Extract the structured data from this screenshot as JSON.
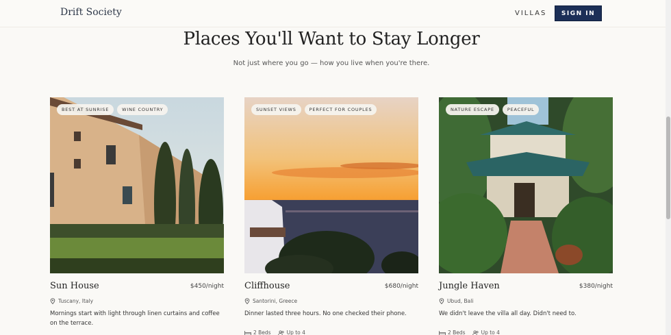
{
  "header": {
    "logo": "Drift Society",
    "nav_villas": "VILLAS",
    "signin": "SIGN IN"
  },
  "hero": {
    "title": "Places You'll Want to Stay Longer",
    "subtitle": "Not just where you go — how you live when you're there."
  },
  "cards": [
    {
      "tags": [
        "BEST AT SUNRISE",
        "WINE COUNTRY"
      ],
      "name": "Sun House",
      "price": "$450/night",
      "location": "Tuscany, Italy",
      "description": "Mornings start with light through linen curtains and coffee on the terrace.",
      "beds": "",
      "guests": ""
    },
    {
      "tags": [
        "SUNSET VIEWS",
        "PERFECT FOR COUPLES"
      ],
      "name": "Cliffhouse",
      "price": "$680/night",
      "location": "Santorini, Greece",
      "description": "Dinner lasted three hours. No one checked their phone.",
      "beds": "2 Beds",
      "guests": "Up to 4"
    },
    {
      "tags": [
        "NATURE ESCAPE",
        "PEACEFUL"
      ],
      "name": "Jungle Haven",
      "price": "$380/night",
      "location": "Ubud, Bali",
      "description": "We didn't leave the villa all day. Didn't need to.",
      "beds": "2 Beds",
      "guests": "Up to 4"
    }
  ]
}
